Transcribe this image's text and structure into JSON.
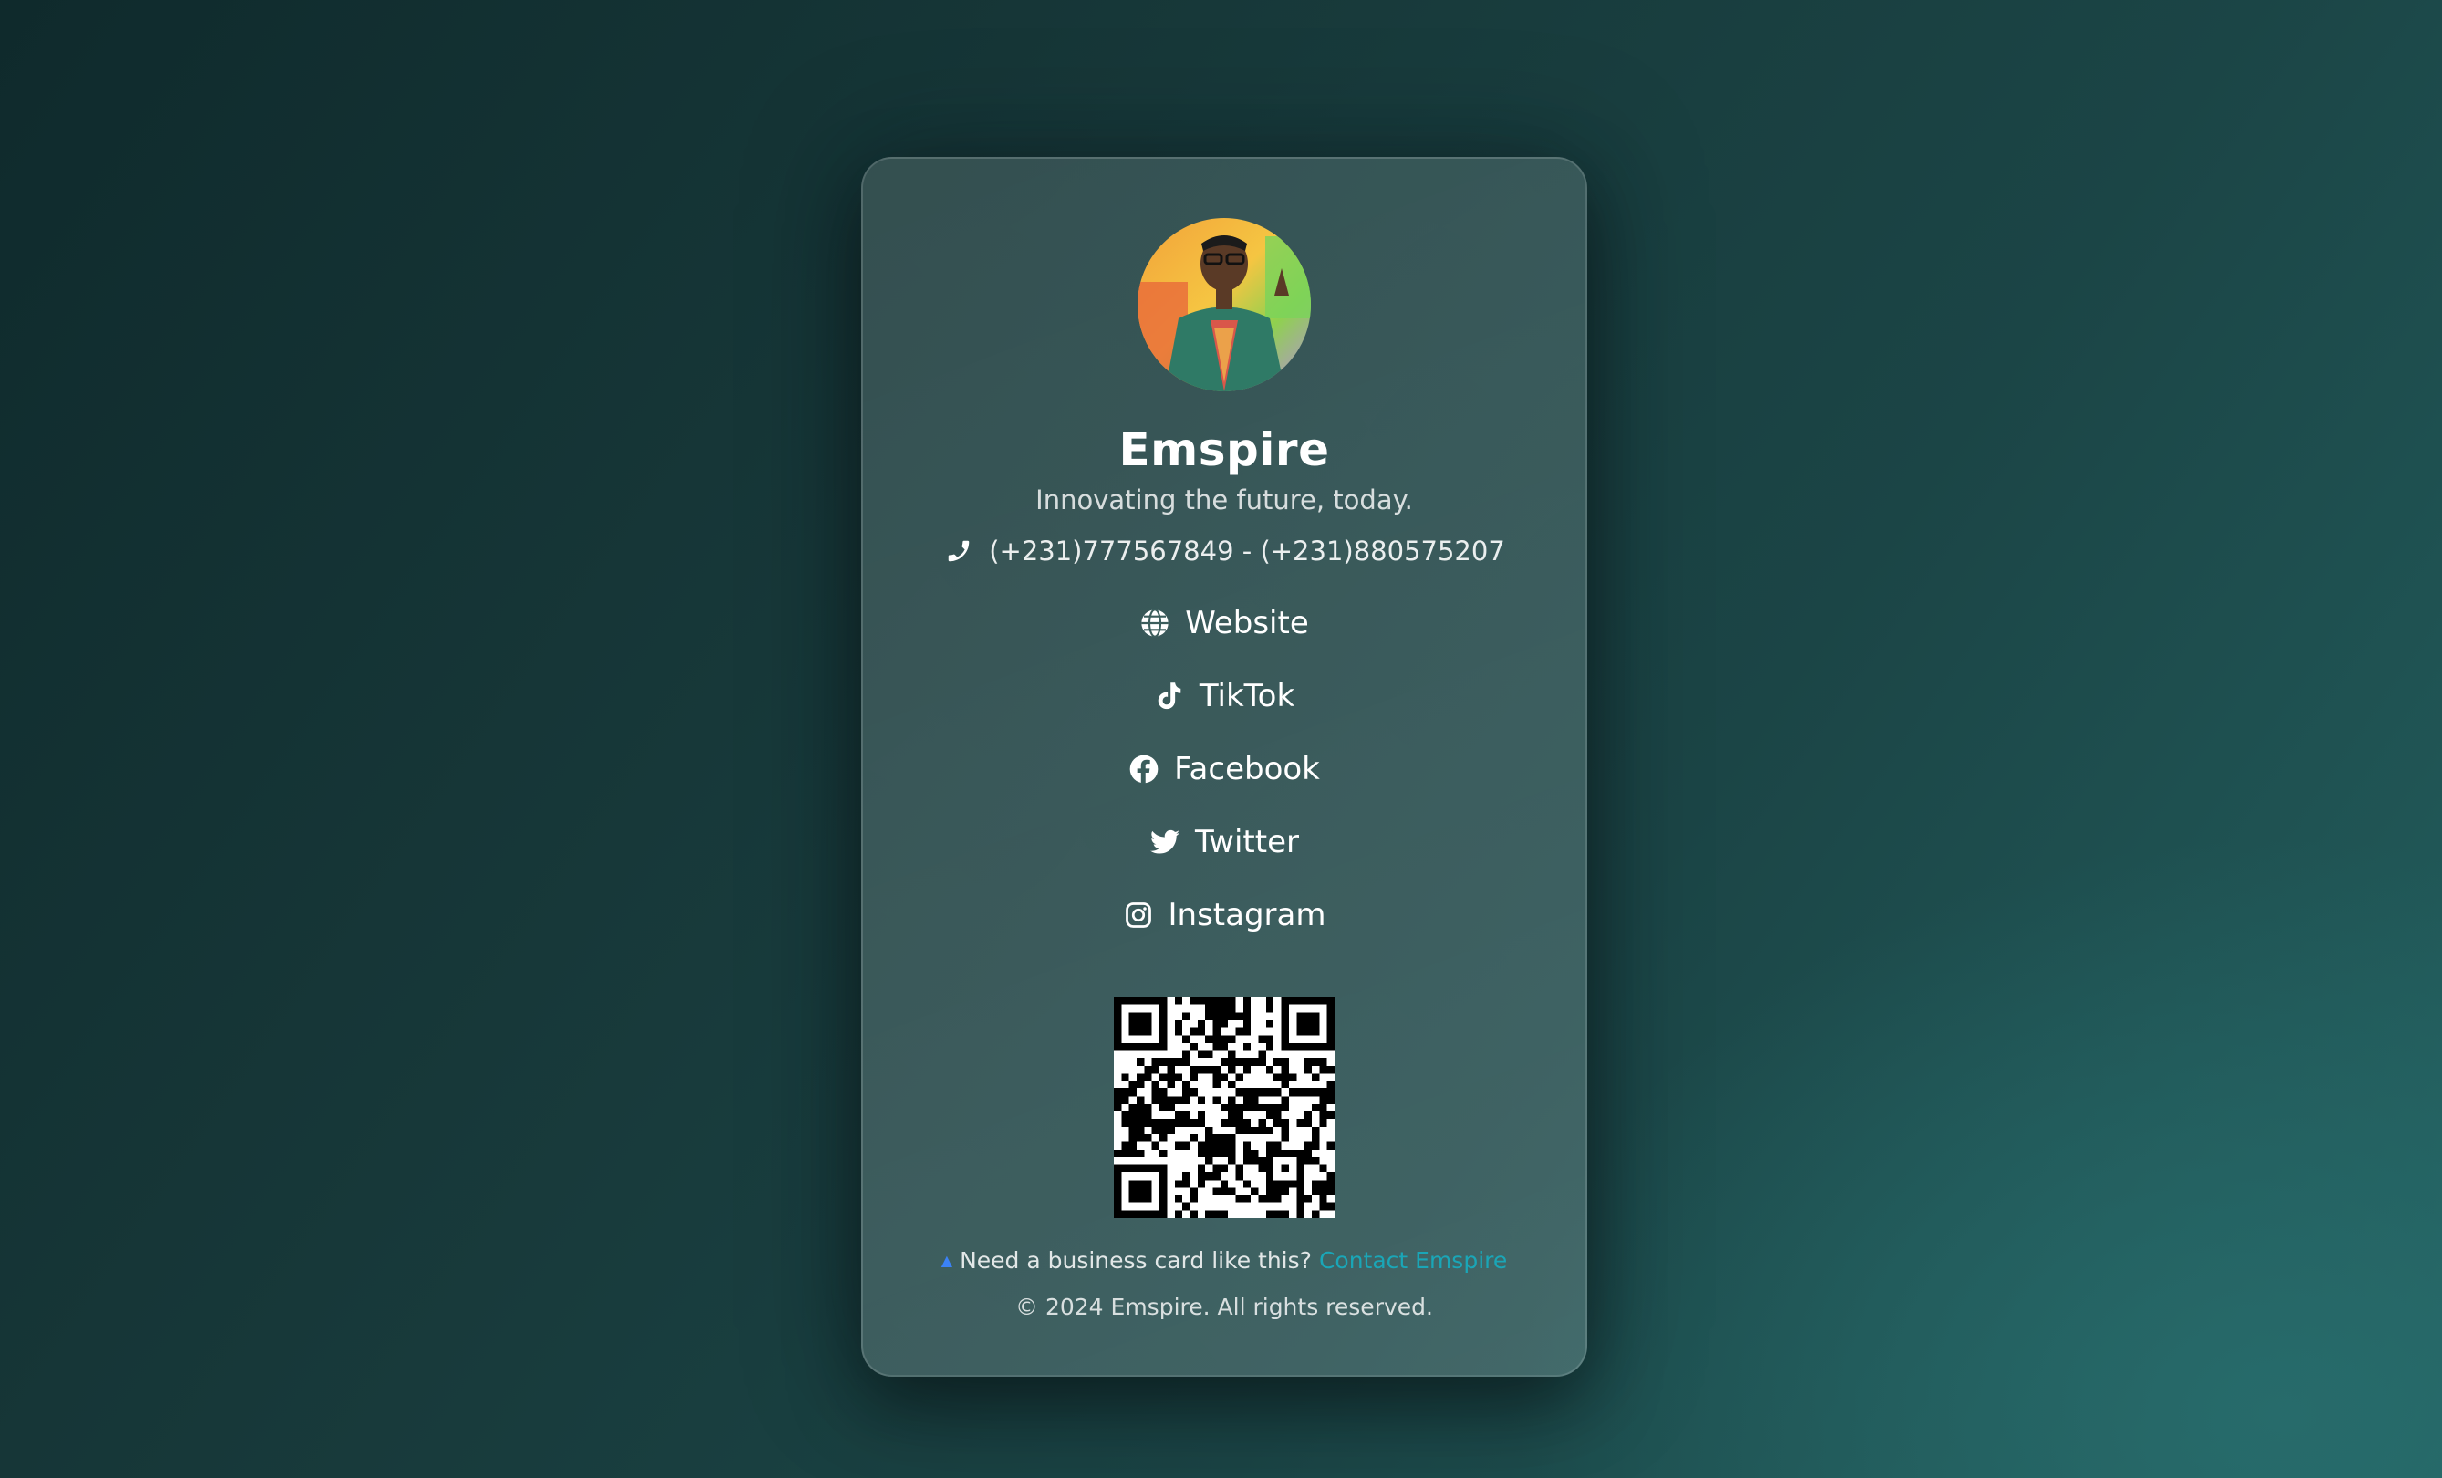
{
  "profile": {
    "name": "Emspire",
    "tagline": "Innovating the future, today.",
    "phone": "(+231)777567849 - (+231)880575207"
  },
  "links": [
    {
      "label": "Website",
      "icon": "globe-icon"
    },
    {
      "label": "TikTok",
      "icon": "tiktok-icon"
    },
    {
      "label": "Facebook",
      "icon": "facebook-icon"
    },
    {
      "label": "Twitter",
      "icon": "twitter-icon"
    },
    {
      "label": "Instagram",
      "icon": "instagram-icon"
    }
  ],
  "footer": {
    "cta_text": "Need a business card like this?",
    "cta_link": "Contact Emspire",
    "cta_icon": "pointer-icon",
    "copyright": "© 2024 Emspire. All rights reserved."
  },
  "colors": {
    "accent_link": "#1aa6b7",
    "text": "#ffffff",
    "background_dark": "#0f2a2c",
    "background_light": "#23605f"
  }
}
